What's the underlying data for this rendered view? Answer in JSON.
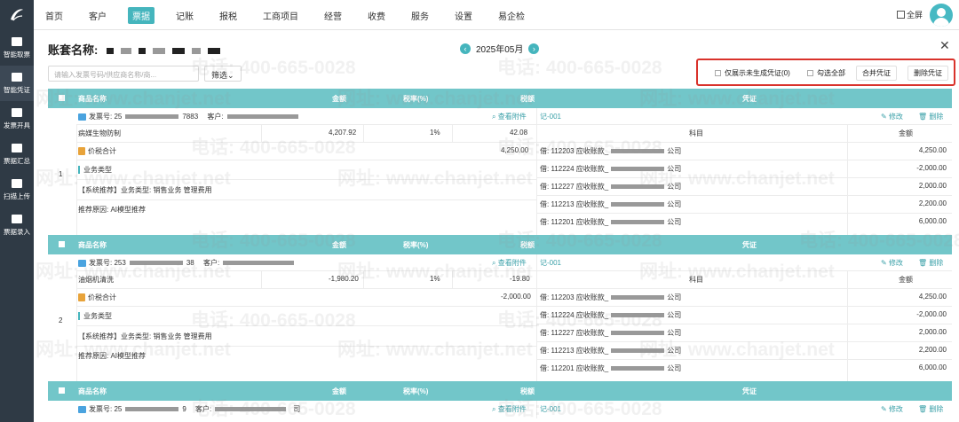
{
  "nav": [
    "首页",
    "客户",
    "票据",
    "记账",
    "报税",
    "工商项目",
    "经营",
    "收费",
    "服务",
    "设置",
    "易企检"
  ],
  "nav_active": 2,
  "fullscreen_label": "全屏",
  "sidebar": [
    "智能取票",
    "智能凭证",
    "发票开具",
    "票据汇总",
    "扫描上传",
    "票据录入"
  ],
  "title_label": "账套名称:",
  "period": "2025年05月",
  "search_placeholder": "请输入发票号码/供应商名称/商...",
  "filter_label": "筛选",
  "actions": {
    "only_unposted": "仅展示未生成凭证(0)",
    "select_all": "勾选全部",
    "merge": "合并凭证",
    "delete": "删除凭证"
  },
  "columns": {
    "name": "商品名称",
    "amount": "金额",
    "rate": "税率(%)",
    "tax": "税额",
    "voucher": "凭证"
  },
  "voucher_cols": {
    "subject": "科目",
    "amount": "金额"
  },
  "labels": {
    "invoice_no": "发票号:",
    "customer": "客户:",
    "view_attach": "查看附件",
    "edit": "修改",
    "delete": "删除",
    "total": "价税合计",
    "biz_type": "业务类型",
    "recommend": "【系统推荐】业务类型:  销售业务  管理费用",
    "reason": "推荐原因: AI模型推荐"
  },
  "groups": [
    {
      "index": "1",
      "invoice_prefix": "25",
      "invoice_suffix": "7883",
      "item": "病媒生物防制",
      "amount": "4,207.92",
      "rate": "1%",
      "tax": "42.08",
      "total": "4,250.00",
      "voucher_no": "记-001",
      "entries": [
        {
          "subject": "借: 112203 应收账款_",
          "tail": "公司",
          "amount": "4,250.00"
        },
        {
          "subject": "借: 112224 应收账款_",
          "tail": "公司",
          "amount": "-2,000.00"
        },
        {
          "subject": "借: 112227 应收账款_",
          "tail": "公司",
          "amount": "2,000.00"
        },
        {
          "subject": "借: 112213 应收账款_",
          "tail": "公司",
          "amount": "2,200.00"
        },
        {
          "subject": "借: 112201 应收账款_",
          "tail": "公司",
          "amount": "6,000.00"
        }
      ]
    },
    {
      "index": "2",
      "invoice_prefix": "253",
      "invoice_suffix": "38",
      "item": "油烟机清洗",
      "amount": "-1,980.20",
      "rate": "1%",
      "tax": "-19.80",
      "total": "-2,000.00",
      "voucher_no": "记-001",
      "entries": [
        {
          "subject": "借: 112203 应收账款_",
          "tail": "公司",
          "amount": "4,250.00"
        },
        {
          "subject": "借: 112224 应收账款_",
          "tail": "公司",
          "amount": "-2,000.00"
        },
        {
          "subject": "借: 112227 应收账款_",
          "tail": "公司",
          "amount": "2,000.00"
        },
        {
          "subject": "借: 112213 应收账款_",
          "tail": "公司",
          "amount": "2,200.00"
        },
        {
          "subject": "借: 112201 应收账款_",
          "tail": "公司",
          "amount": "6,000.00"
        }
      ]
    },
    {
      "index": "",
      "invoice_prefix": "25",
      "invoice_suffix": "9",
      "customer_tail": "司",
      "voucher_no": "记-001"
    }
  ],
  "watermark_phone": "电话: 400-665-0028",
  "watermark_url": "网址: www.chanjet.net"
}
